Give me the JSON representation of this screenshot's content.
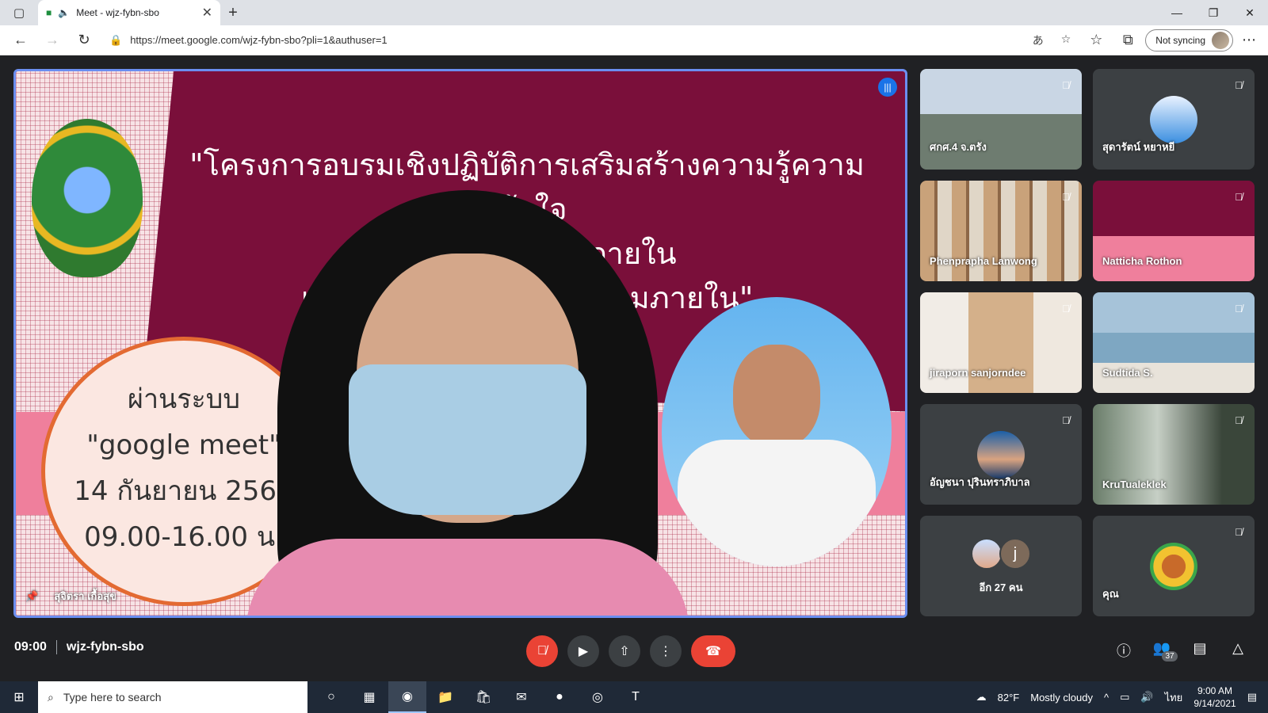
{
  "browser": {
    "tab_title": "Meet - wjz-fybn-sbo",
    "url": "https://meet.google.com/wjz-fybn-sbo?pli=1&authuser=1",
    "sync_label": "Not syncing"
  },
  "main_video": {
    "slide_title_lines": [
      "\"โครงการอบรมเชิงปฏิบัติการเสริมสร้างความรู้ความเข้าใจ",
      "เกี่ยวกับระบบ... ภายใน",
      "และการขยายผล... ควบคุมภายใน\""
    ],
    "bubble_lines": [
      "ผ่านระบบ",
      "\"google meet\"",
      "14 กันยายน 2564",
      "09.00-16.00 น."
    ],
    "speaker_name": "สุจิตรา เกื้อสุข"
  },
  "tiles": [
    {
      "name": "ศกศ.4 จ.ตรัง",
      "bg": "office"
    },
    {
      "name": "สุดารัตน์ หยาหยี",
      "bg": "avatar"
    },
    {
      "name": "Phenprapha Lanwong",
      "bg": "books"
    },
    {
      "name": "Natticha Rothon",
      "bg": "slide"
    },
    {
      "name": "jiraporn sanjorndee",
      "bg": "shelf"
    },
    {
      "name": "Sudtida S.",
      "bg": "sea"
    },
    {
      "name": "อัญชนา ปุรินทราภิบาล",
      "bg": "avatar"
    },
    {
      "name": "KruTualeklek",
      "bg": "forest"
    }
  ],
  "more_participants": {
    "label": "อีก 27 คน",
    "avatar_letter": "j"
  },
  "self_tile": {
    "name": "คุณ"
  },
  "meeting": {
    "time": "09:00",
    "code": "wjz-fybn-sbo",
    "participant_count": "37"
  },
  "taskbar": {
    "search_placeholder": "Type here to search",
    "weather_temp": "82°F",
    "weather_desc": "Mostly cloudy",
    "language": "ไทย",
    "time": "9:00 AM",
    "date": "9/14/2021"
  },
  "colors": {
    "accent": "#1a73e8",
    "end_call": "#ea4335",
    "meet_bg": "#202124"
  }
}
